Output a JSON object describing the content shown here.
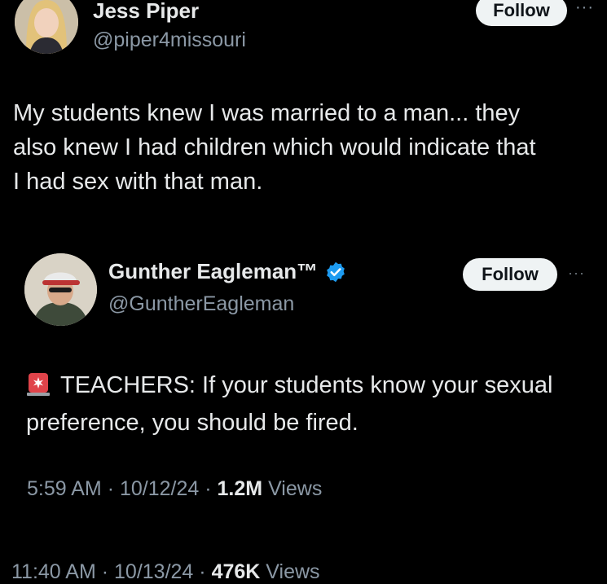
{
  "outer_tweet": {
    "author_name": "Jess Piper",
    "author_handle": "@piper4missouri",
    "follow_label": "Follow",
    "more_label": "···",
    "text": "My students knew I was married to a man... they\nalso knew I had children which would indicate that\nI had sex with that man.",
    "time": "11:40 AM",
    "date": "10/13/24",
    "views_count": "476K",
    "views_label": "Views",
    "separator": "·"
  },
  "quoted_tweet": {
    "author_name": "Gunther Eagleman™",
    "author_handle": "@GuntherEagleman",
    "verified_icon": "verified-badge-icon",
    "follow_label": "Follow",
    "more_label": "···",
    "emoji_icon": "police-siren-icon",
    "text": "TEACHERS: If your students know your sexual preference, you should be fired.",
    "time": "5:59 AM",
    "date": "10/12/24",
    "views_count": "1.2M",
    "views_label": "Views",
    "separator": "·"
  },
  "colors": {
    "background": "#000000",
    "text_primary": "#e7e9ea",
    "text_secondary": "#8b98a5",
    "follow_button_bg": "#eff3f4",
    "verified_blue": "#1d9bf0"
  }
}
